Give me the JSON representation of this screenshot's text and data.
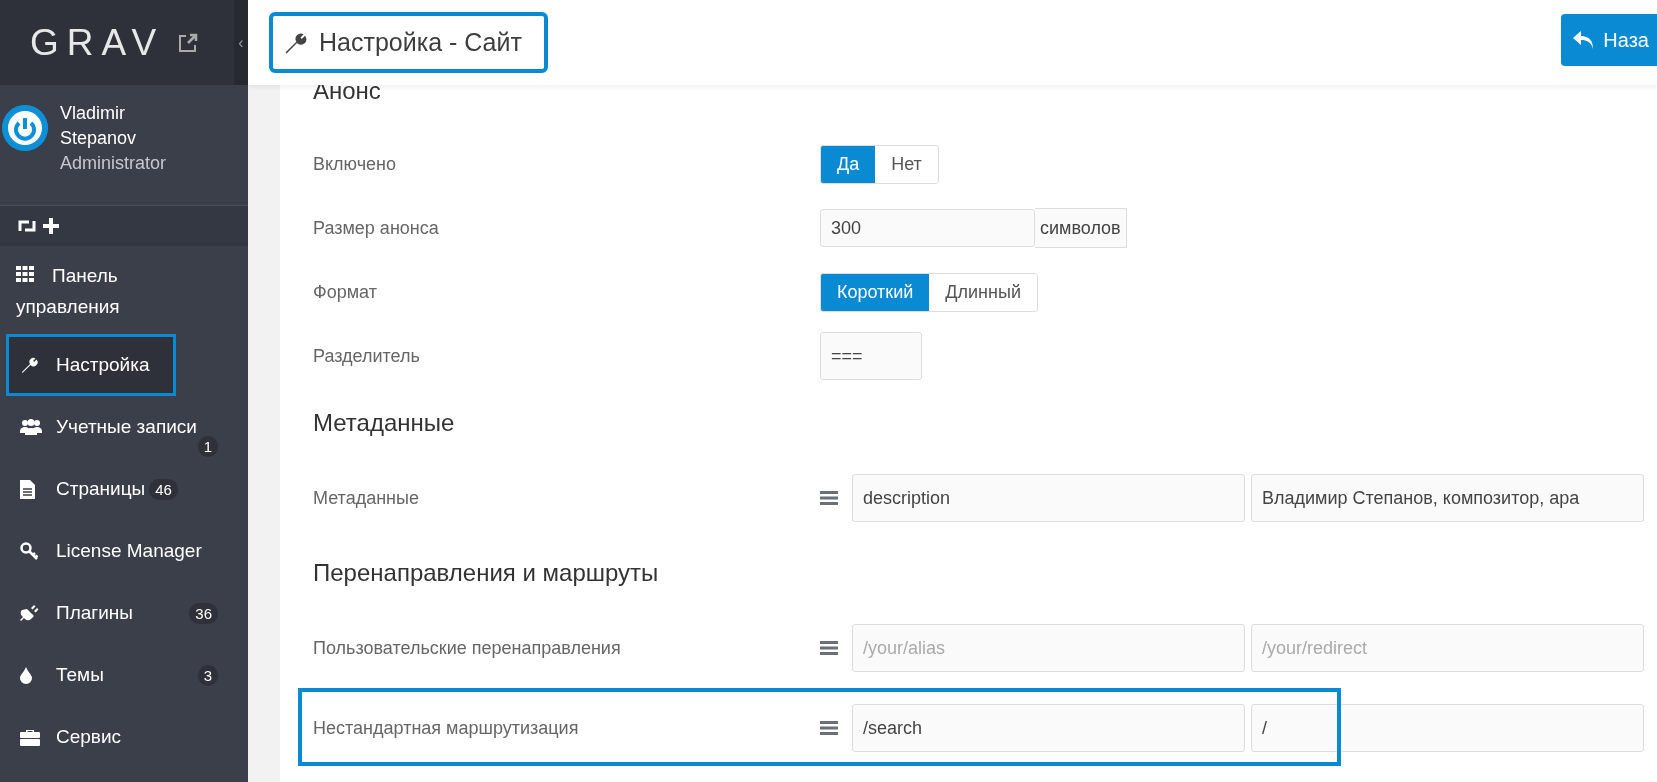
{
  "sidebar": {
    "logo": "GRAV",
    "collapse": "‹",
    "user": {
      "name": "Vladimir Stepanov",
      "role": "Administrator"
    },
    "nav": [
      {
        "label": "Панель управления",
        "selected": false,
        "highlighted": false
      },
      {
        "label": "Настройка",
        "selected": true,
        "highlighted": true
      },
      {
        "label": "Учетные записи",
        "selected": false,
        "highlighted": false,
        "badge": "1"
      },
      {
        "label": "Страницы",
        "selected": false,
        "highlighted": false,
        "badge": "46"
      },
      {
        "label": "License Manager",
        "selected": false,
        "highlighted": false
      },
      {
        "label": "Плагины",
        "selected": false,
        "highlighted": false,
        "badge": "36"
      },
      {
        "label": "Темы",
        "selected": false,
        "highlighted": false,
        "badge": "3"
      },
      {
        "label": "Сервис",
        "selected": false,
        "highlighted": false
      }
    ]
  },
  "header": {
    "title": "Настройка - Сайт",
    "highlighted": true,
    "back_button": "Наза"
  },
  "sections": [
    {
      "heading": "Анонс",
      "rows": [
        {
          "kind": "toggle",
          "label": "Включено",
          "options": [
            {
              "label": "Да",
              "selected": true
            },
            {
              "label": "Нет",
              "selected": false
            }
          ]
        },
        {
          "kind": "addon",
          "label": "Размер анонса",
          "value": "300",
          "addon": "символов"
        },
        {
          "kind": "toggle",
          "label": "Формат",
          "options": [
            {
              "label": "Короткий",
              "selected": true
            },
            {
              "label": "Длинный",
              "selected": false
            }
          ]
        },
        {
          "kind": "input",
          "label": "Разделитель",
          "value": "==="
        }
      ]
    },
    {
      "heading": "Метаданные",
      "rows": [
        {
          "kind": "pairs",
          "label": "Метаданные",
          "highlighted": false,
          "key": {
            "value": "description"
          },
          "value": {
            "value": "Владимир Степанов, композитор, ара"
          }
        }
      ]
    },
    {
      "heading": "Перенаправления и маршруты",
      "rows": [
        {
          "kind": "pairs",
          "label": "Пользовательские перенаправления",
          "highlighted": false,
          "key": {
            "placeholder": "/your/alias"
          },
          "value": {
            "placeholder": "/your/redirect"
          }
        },
        {
          "kind": "pairs",
          "label": "Нестандартная маршрутизация",
          "highlighted": true,
          "key": {
            "value": "/search"
          },
          "value": {
            "value": "/"
          }
        }
      ]
    }
  ]
}
